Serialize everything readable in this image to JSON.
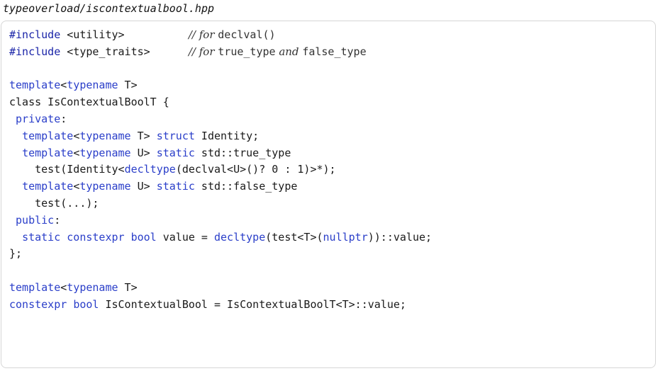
{
  "file": {
    "name": "typeoverload/iscontextualbool.hpp"
  },
  "colors": {
    "keyword": "#2a3ec9",
    "preprocessor": "#1a24a8",
    "text": "#1a1a1a",
    "comment": "#333333",
    "border": "#d6d6d6"
  },
  "code": {
    "lines": [
      [
        {
          "t": "pp",
          "v": "#include"
        },
        {
          "t": "plain",
          "v": " <utility>          "
        },
        {
          "t": "cmt",
          "v": "// for "
        },
        {
          "t": "cmtcode",
          "v": "declval()"
        }
      ],
      [
        {
          "t": "pp",
          "v": "#include"
        },
        {
          "t": "plain",
          "v": " <type_traits>      "
        },
        {
          "t": "cmt",
          "v": "// for "
        },
        {
          "t": "cmtcode",
          "v": "true_type"
        },
        {
          "t": "cmt",
          "v": " and "
        },
        {
          "t": "cmtcode",
          "v": "false_type"
        }
      ],
      [],
      [
        {
          "t": "kw",
          "v": "template"
        },
        {
          "t": "plain",
          "v": "<"
        },
        {
          "t": "kw",
          "v": "typename"
        },
        {
          "t": "plain",
          "v": " T>"
        }
      ],
      [
        {
          "t": "plain",
          "v": "class IsContextualBoolT {"
        }
      ],
      [
        {
          "t": "plain",
          "v": " "
        },
        {
          "t": "kw",
          "v": "private"
        },
        {
          "t": "plain",
          "v": ":"
        }
      ],
      [
        {
          "t": "plain",
          "v": "  "
        },
        {
          "t": "kw",
          "v": "template"
        },
        {
          "t": "plain",
          "v": "<"
        },
        {
          "t": "kw",
          "v": "typename"
        },
        {
          "t": "plain",
          "v": " T> "
        },
        {
          "t": "kw",
          "v": "struct"
        },
        {
          "t": "plain",
          "v": " Identity;"
        }
      ],
      [
        {
          "t": "plain",
          "v": "  "
        },
        {
          "t": "kw",
          "v": "template"
        },
        {
          "t": "plain",
          "v": "<"
        },
        {
          "t": "kw",
          "v": "typename"
        },
        {
          "t": "plain",
          "v": " U> "
        },
        {
          "t": "kw",
          "v": "static"
        },
        {
          "t": "plain",
          "v": " std::true_type"
        }
      ],
      [
        {
          "t": "plain",
          "v": "    test(Identity<"
        },
        {
          "t": "kw",
          "v": "decltype"
        },
        {
          "t": "plain",
          "v": "(declval<U>()? 0 : 1)>*);"
        }
      ],
      [
        {
          "t": "plain",
          "v": "  "
        },
        {
          "t": "kw",
          "v": "template"
        },
        {
          "t": "plain",
          "v": "<"
        },
        {
          "t": "kw",
          "v": "typename"
        },
        {
          "t": "plain",
          "v": " U> "
        },
        {
          "t": "kw",
          "v": "static"
        },
        {
          "t": "plain",
          "v": " std::false_type"
        }
      ],
      [
        {
          "t": "plain",
          "v": "    test(...);"
        }
      ],
      [
        {
          "t": "plain",
          "v": " "
        },
        {
          "t": "kw",
          "v": "public"
        },
        {
          "t": "plain",
          "v": ":"
        }
      ],
      [
        {
          "t": "plain",
          "v": "  "
        },
        {
          "t": "kw",
          "v": "static"
        },
        {
          "t": "plain",
          "v": " "
        },
        {
          "t": "kw",
          "v": "constexpr"
        },
        {
          "t": "plain",
          "v": " "
        },
        {
          "t": "kw",
          "v": "bool"
        },
        {
          "t": "plain",
          "v": " value = "
        },
        {
          "t": "kw",
          "v": "decltype"
        },
        {
          "t": "plain",
          "v": "(test<T>("
        },
        {
          "t": "kw",
          "v": "nullptr"
        },
        {
          "t": "plain",
          "v": "))::value;"
        }
      ],
      [
        {
          "t": "plain",
          "v": "};"
        }
      ],
      [],
      [
        {
          "t": "kw",
          "v": "template"
        },
        {
          "t": "plain",
          "v": "<"
        },
        {
          "t": "kw",
          "v": "typename"
        },
        {
          "t": "plain",
          "v": " T>"
        }
      ],
      [
        {
          "t": "kw",
          "v": "constexpr"
        },
        {
          "t": "plain",
          "v": " "
        },
        {
          "t": "kw",
          "v": "bool"
        },
        {
          "t": "plain",
          "v": " IsContextualBool = IsContextualBoolT<T>::value;"
        }
      ]
    ]
  }
}
